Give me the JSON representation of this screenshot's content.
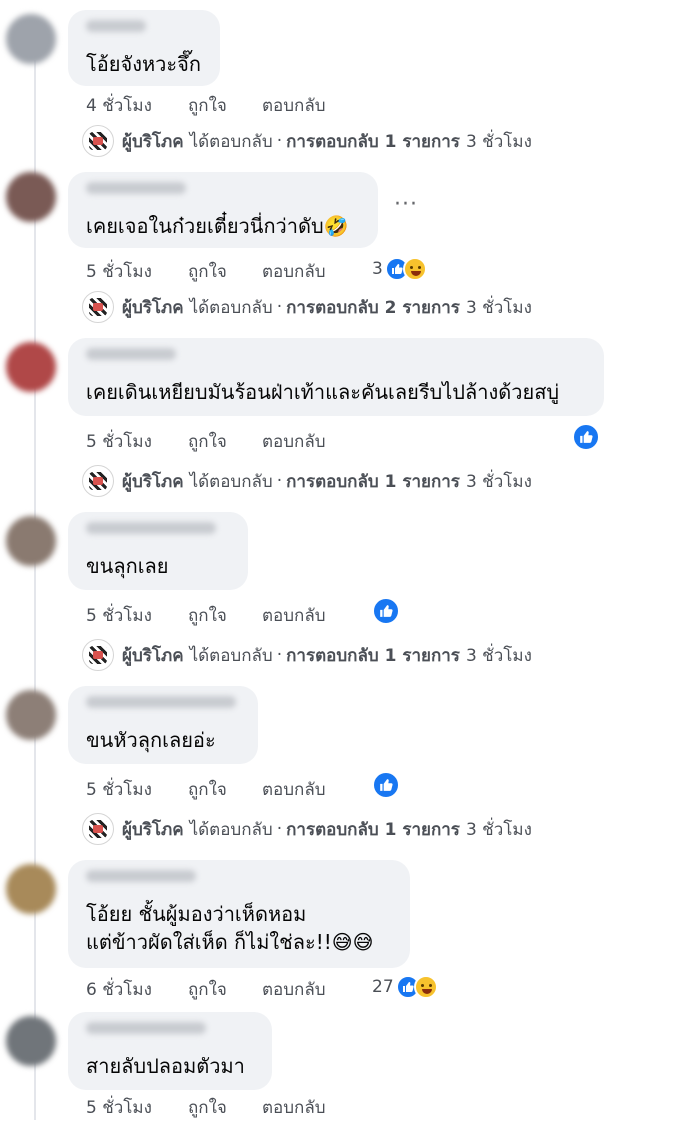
{
  "comments": [
    {
      "text": "โอ้ยจังหวะจึ๊ก",
      "time": "4 ชั่วโมง",
      "like": "ถูกใจ",
      "reply": "ตอบกลับ",
      "reaction_count": "",
      "reply_summary": {
        "author": "ผู้บริโภค",
        "action": "ได้ตอบกลับ",
        "sep": "·",
        "count_text": "การตอบกลับ 1 รายการ",
        "time": "3 ชั่วโมง"
      }
    },
    {
      "text": "เคยเจอในก๋วยเตี๋ยวนี่กว่าดับ🤣",
      "time": "5 ชั่วโมง",
      "like": "ถูกใจ",
      "reply": "ตอบกลับ",
      "reaction_count": "3",
      "reply_summary": {
        "author": "ผู้บริโภค",
        "action": "ได้ตอบกลับ",
        "sep": "·",
        "count_text": "การตอบกลับ 2 รายการ",
        "time": "3 ชั่วโมง"
      }
    },
    {
      "text": "เคยเดินเหยียบมันร้อนฝ่าเท้าและคันเลยรีบไปล้างด้วยสบู่",
      "time": "5 ชั่วโมง",
      "like": "ถูกใจ",
      "reply": "ตอบกลับ",
      "reaction_count": "",
      "reply_summary": {
        "author": "ผู้บริโภค",
        "action": "ได้ตอบกลับ",
        "sep": "·",
        "count_text": "การตอบกลับ 1 รายการ",
        "time": "3 ชั่วโมง"
      }
    },
    {
      "text": "ขนลุกเลย",
      "time": "5 ชั่วโมง",
      "like": "ถูกใจ",
      "reply": "ตอบกลับ",
      "reaction_count": "",
      "reply_summary": {
        "author": "ผู้บริโภค",
        "action": "ได้ตอบกลับ",
        "sep": "·",
        "count_text": "การตอบกลับ 1 รายการ",
        "time": "3 ชั่วโมง"
      }
    },
    {
      "text": "ขนหัวลุกเลยอ่ะ",
      "time": "5 ชั่วโมง",
      "like": "ถูกใจ",
      "reply": "ตอบกลับ",
      "reaction_count": "",
      "reply_summary": {
        "author": "ผู้บริโภค",
        "action": "ได้ตอบกลับ",
        "sep": "·",
        "count_text": "การตอบกลับ 1 รายการ",
        "time": "3 ชั่วโมง"
      }
    },
    {
      "text_lines": [
        "โอ้ยย ชั้นผู้มองว่าเห็ดหอม",
        "แต่ข้าวผัดใส่เห็ด ก็ไม่ใช่ละ!!😅😅"
      ],
      "time": "6 ชั่วโมง",
      "like": "ถูกใจ",
      "reply": "ตอบกลับ",
      "reaction_count": "27"
    },
    {
      "text": "สายลับปลอมตัวมา",
      "time": "5 ชั่วโมง",
      "like": "ถูกใจ",
      "reply": "ตอบกลับ",
      "reaction_count": ""
    }
  ],
  "icons": {
    "more": "more-horizontal-icon",
    "like_reaction": "like-reaction-icon",
    "haha_reaction": "haha-reaction-icon",
    "page_avatar": "page-avatar-icon"
  },
  "colors": {
    "like_blue": "#1877f2",
    "bubble_bg": "#f0f2f5",
    "meta_text": "#4b4f56"
  }
}
